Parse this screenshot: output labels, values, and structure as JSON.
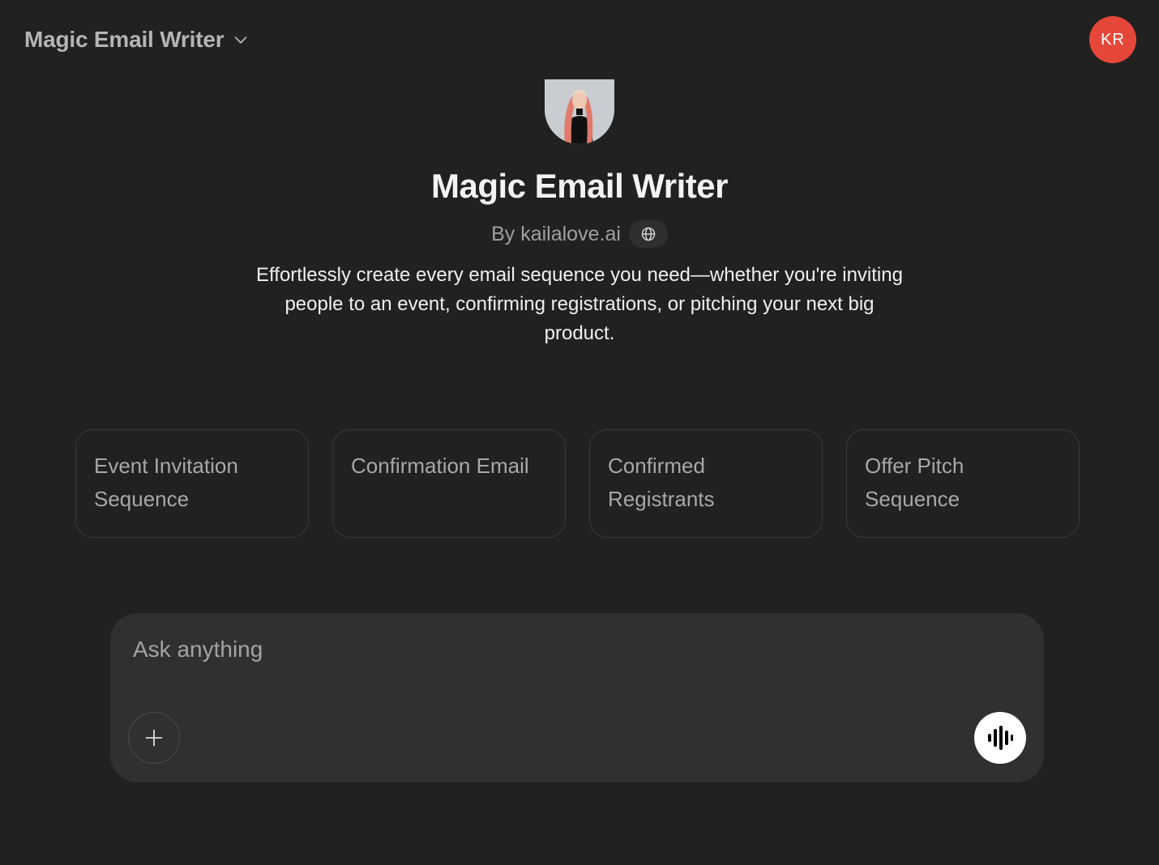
{
  "header": {
    "model_name": "Magic Email Writer",
    "user_initials": "KR",
    "user_avatar_color": "#e5483a"
  },
  "gpt": {
    "title": "Magic Email Writer",
    "author": "By kailalove.ai",
    "description": "Effortlessly create every email sequence you need—whether you're inviting people to an event, confirming registrations, or pitching your next big product."
  },
  "starters": [
    {
      "label": "Event Invitation Sequence"
    },
    {
      "label": "Confirmation Email"
    },
    {
      "label": "Confirmed Registrants"
    },
    {
      "label": "Offer Pitch Sequence"
    }
  ],
  "composer": {
    "placeholder": "Ask anything"
  },
  "icons": {
    "header_chevron": "chevron-down-icon",
    "globe": "globe-icon",
    "attach": "plus-icon",
    "voice": "voice-waveform-icon"
  }
}
